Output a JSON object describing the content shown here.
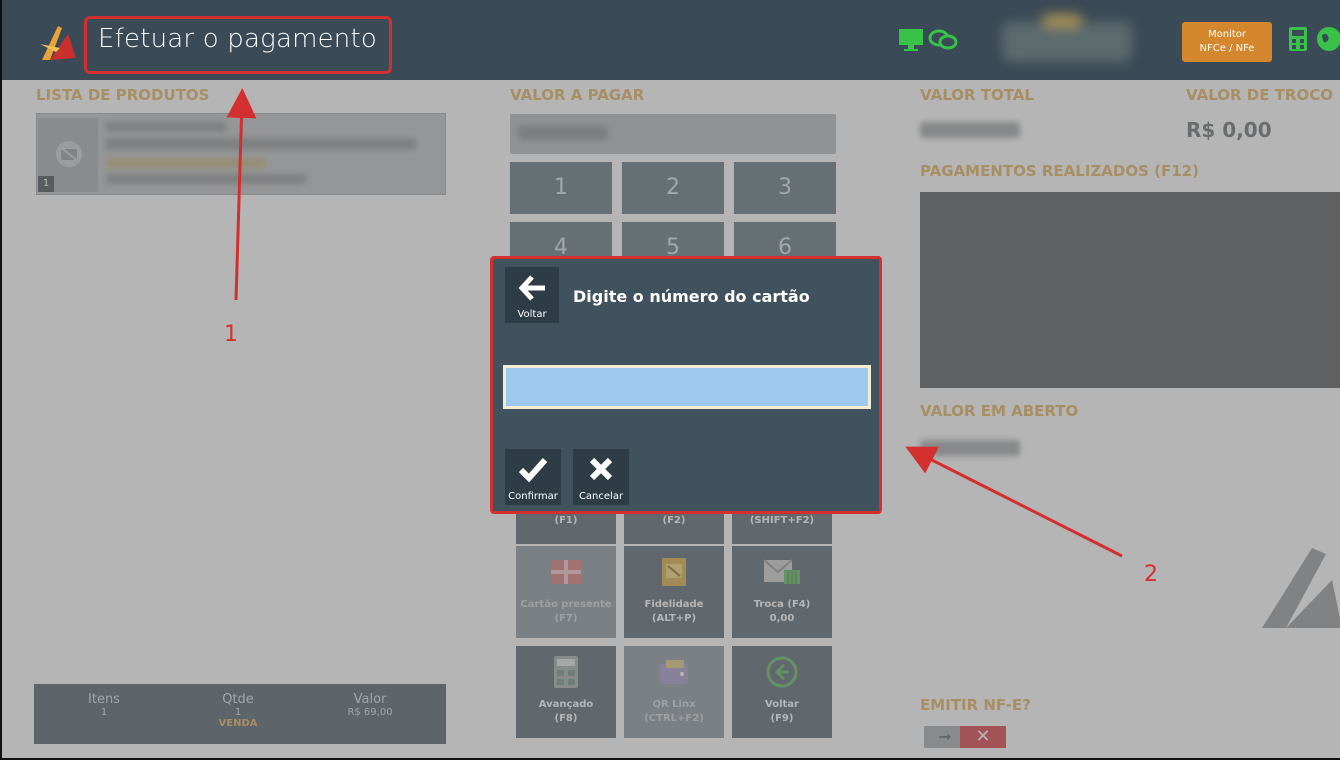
{
  "header": {
    "title": "Efetuar o pagamento",
    "monitor_line1": "Monitor",
    "monitor_line2": "NFCe / NFe"
  },
  "left": {
    "products_label": "LISTA DE PRODUTOS",
    "product_index": "1",
    "footer": {
      "items_label": "Itens",
      "items_value": "1",
      "qty_label": "Qtde",
      "qty_value": "1",
      "qty_sub": "VENDA",
      "value_label": "Valor",
      "value_value": "R$ 69,00"
    }
  },
  "middle": {
    "pay_label": "VALOR A PAGAR",
    "keys": [
      "1",
      "2",
      "3",
      "4",
      "5",
      "6"
    ],
    "fn_top": [
      "(F1)",
      "(F2)",
      "(SHIFT+F2)"
    ],
    "gift": {
      "line1": "Cartão presente",
      "line2": "(F7)"
    },
    "loyalty": {
      "line1": "Fidelidade",
      "line2": "(ALT+P)"
    },
    "exchange": {
      "line1": "Troca (F4)",
      "line2": "0,00"
    },
    "advanced": {
      "line1": "Avançado",
      "line2": "(F8)"
    },
    "qr": {
      "line1": "QR Linx",
      "line2": "(CTRL+F2)"
    },
    "back": {
      "line1": "Voltar",
      "line2": "(F9)"
    }
  },
  "right": {
    "total_label": "VALOR TOTAL",
    "change_label": "VALOR DE TROCO",
    "change_value": "R$ 0,00",
    "payments_label": "PAGAMENTOS REALIZADOS (F12)",
    "open_label": "VALOR EM ABERTO",
    "nfe_label": "EMITIR NF-E?",
    "nfe_off": "✕"
  },
  "dialog": {
    "back_label": "Voltar",
    "title": "Digite o número do cartão",
    "card_value": "",
    "confirm_label": "Confirmar",
    "cancel_label": "Cancelar"
  },
  "annotations": {
    "one": "1",
    "two": "2"
  },
  "colors": {
    "header_bg": "#3a4a56",
    "accent_orange": "#d4872d",
    "annotation_red": "#d32f2f",
    "dialog_bg": "#40525d"
  }
}
